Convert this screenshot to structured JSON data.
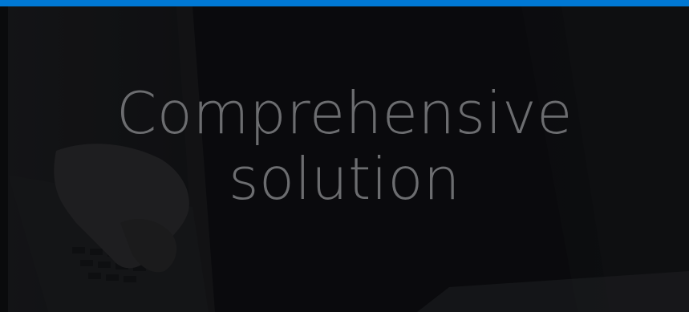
{
  "hero": {
    "headline_line1": "Comprehensive",
    "headline_line2": "solution",
    "background_image": "person-typing-on-laptop-photo"
  },
  "colors": {
    "accent_bar": "#0078d4",
    "headline_text": "#6c6d70",
    "background": "#0e0f11"
  }
}
